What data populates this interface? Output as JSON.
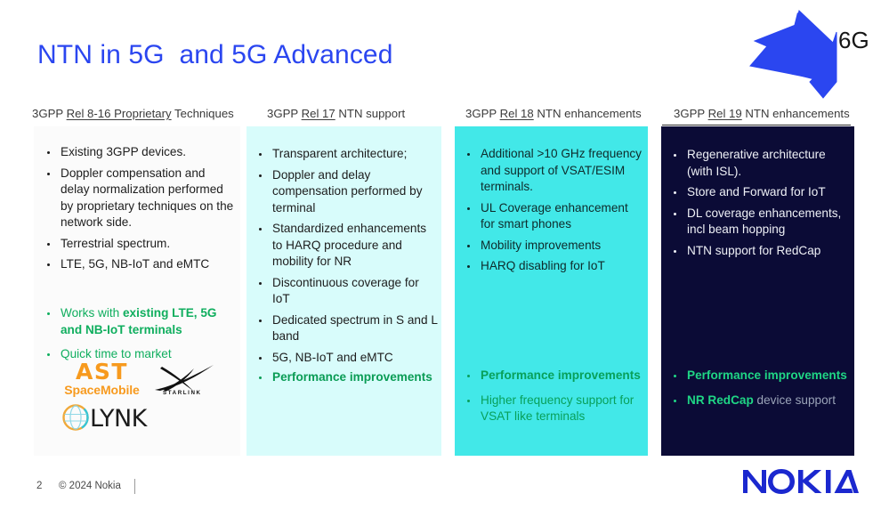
{
  "slide": {
    "title": "NTN in 5G  and 5G Advanced",
    "title_color": "#2b46f0",
    "background": "#ffffff"
  },
  "arrow": {
    "name": "6g-arrow",
    "label": "6G",
    "color": "#2b46f0"
  },
  "columns": [
    {
      "id": "rel8-16",
      "header_prefix": "3GPP ",
      "header_underlined": "Rel 8-16  Proprietary",
      "header_suffix": " Techniques",
      "background": "#fbfbfb",
      "text_color": "#1d1d1d",
      "bullets": [
        "Existing 3GPP devices.",
        "Doppler compensation and delay normalization performed by proprietary techniques on the network side.",
        "Terrestrial spectrum.",
        "LTE, 5G, NB-IoT and eMTC"
      ],
      "highlight_color": "#0fae5e",
      "highlights": [
        {
          "plain_lead": "Works with ",
          "bold": "existing LTE, 5G and NB-IoT terminals",
          "plain_tail": ""
        },
        {
          "plain_lead": "Quick time to market",
          "bold": "",
          "plain_tail": ""
        }
      ],
      "logos": [
        {
          "name": "ast-spacemobile-logo",
          "word": "AST",
          "sub": "SpaceMobile",
          "color": "#f79a1e"
        },
        {
          "name": "starlink-logo",
          "word": "STARLINK",
          "color": "#111111"
        },
        {
          "name": "lynk-logo",
          "word": "LYNK",
          "color": "#1c1c1c"
        }
      ]
    },
    {
      "id": "rel17",
      "header_prefix": "3GPP ",
      "header_underlined": "Rel 17",
      "header_suffix": " NTN support",
      "background": "#d8fcfb",
      "text_color": "#1d1d1d",
      "bullets": [
        "Transparent architecture;",
        "Doppler and delay compensation performed by terminal",
        "Standardized enhancements to HARQ procedure and mobility for NR",
        "Discontinuous coverage for IoT",
        "Dedicated spectrum in S and L band",
        "5G, NB-IoT and eMTC"
      ],
      "highlight_color": "#0a9c55",
      "highlights": [
        {
          "plain_lead": "",
          "bold": "Performance improvements",
          "plain_tail": ""
        }
      ],
      "logos": []
    },
    {
      "id": "rel18",
      "header_prefix": "3GPP ",
      "header_underlined": "Rel 18",
      "header_suffix": " NTN enhancements",
      "background": "#42e8e8",
      "text_color": "#0e2b2b",
      "bullets": [
        "Additional >10 GHz frequency and support of VSAT/ESIM terminals.",
        "UL Coverage enhancement for smart phones",
        "Mobility improvements",
        "HARQ disabling for IoT"
      ],
      "highlight_color": "#08a05a",
      "highlights": [
        {
          "plain_lead": "",
          "bold": "Performance improvements",
          "plain_tail": ""
        },
        {
          "plain_lead": "Higher frequency support for VSAT like terminals",
          "bold": "",
          "plain_tail": ""
        }
      ],
      "logos": []
    },
    {
      "id": "rel19",
      "header_prefix": "3GPP ",
      "header_underlined": "Rel 19",
      "header_suffix": " NTN enhancements",
      "background": "#0b0b36",
      "text_color": "#eef0f6",
      "bullets": [
        "Regenerative architecture (with ISL).",
        "Store and Forward for IoT",
        "DL coverage enhancements, incl beam hopping",
        "NTN support for RedCap"
      ],
      "highlight_color": "#1fd685",
      "highlights": [
        {
          "plain_lead": "",
          "bold": "Performance improvements",
          "plain_tail": ""
        },
        {
          "plain_lead": "",
          "bold": "NR RedCap",
          "plain_tail": " device support"
        }
      ],
      "logos": []
    }
  ],
  "footer": {
    "page_number": "2",
    "copyright": "© 2024 Nokia",
    "brand": "NOKIA",
    "brand_color": "#1b28cf"
  }
}
